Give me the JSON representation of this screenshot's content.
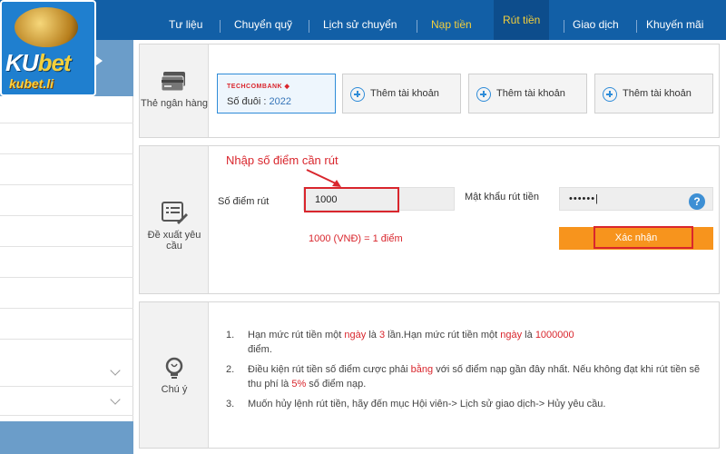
{
  "brand": {
    "logo_text_ku": "KU",
    "logo_text_bet": "bet",
    "domain": "kubet.li"
  },
  "nav": {
    "items": [
      {
        "label": "Tư liệu"
      },
      {
        "label": "Chuyển quỹ"
      },
      {
        "label": "Lịch sử chuyển"
      },
      {
        "label": "Nạp tiền"
      },
      {
        "label": "Rút tiền"
      },
      {
        "label": "Giao dịch"
      },
      {
        "label": "Khuyến mãi"
      }
    ],
    "active": "Rút tiền"
  },
  "bank_section": {
    "caption": "Thẻ ngân hàng",
    "card": {
      "bank_name": "TECHCOMBANK",
      "suffix_label": "Số đuôi :",
      "suffix_value": "2022"
    },
    "add_buttons": [
      "Thêm tài khoản",
      "Thêm tài khoản",
      "Thêm tài khoản"
    ]
  },
  "withdraw_section": {
    "caption": "Đề xuất yêu cầu",
    "hint": "Nhập số điểm cần rút",
    "points_label": "Số điểm rút",
    "points_value": "1000",
    "password_label": "Mật khẩu rút tiền",
    "password_value": "••••••|",
    "help": "?",
    "rate": "1000 (VNĐ) = 1 điểm",
    "confirm": "Xác nhận"
  },
  "notes_section": {
    "caption": "Chú ý",
    "items": [
      {
        "n": "1.",
        "parts": [
          "Hạn mức rút tiền một ",
          "ngày",
          " là ",
          "3",
          " lần.Hạn mức rút tiền một ",
          "ngày",
          " là ",
          "1000000",
          " điểm."
        ]
      },
      {
        "n": "2.",
        "parts": [
          "Điều kiện rút tiền số điểm cược phải ",
          "bằng",
          " với số điểm nạp gần đây nhất. Nếu không đạt khi rút tiền sẽ thu phí là ",
          "5%",
          " số điểm nạp."
        ]
      },
      {
        "n": "3.",
        "parts": [
          "Muốn hủy lệnh rút tiền, hãy đến mục Hội viên-> Lịch sử giao dịch-> Hủy yêu cầu."
        ]
      }
    ]
  },
  "colors": {
    "nav_bg": "#125fa6",
    "accent_gold": "#f3cf3c",
    "alert_red": "#d9262d",
    "confirm_orange": "#f7941d",
    "link_blue": "#2f8cd8"
  }
}
